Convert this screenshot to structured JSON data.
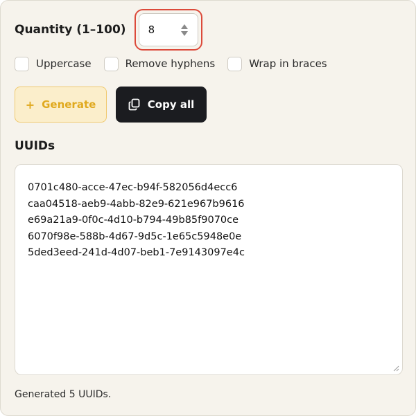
{
  "quantity": {
    "label": "Quantity (1–100)",
    "value": "8"
  },
  "options": [
    {
      "label": "Uppercase",
      "checked": false
    },
    {
      "label": "Remove hyphens",
      "checked": false
    },
    {
      "label": "Wrap in braces",
      "checked": false
    }
  ],
  "buttons": {
    "generate_icon": "+",
    "generate_label": "Generate",
    "copy_label": "Copy all"
  },
  "output": {
    "title": "UUIDs",
    "uuids": [
      "0701c480-acce-47ec-b94f-582056d4ecc6",
      "caa04518-aeb9-4abb-82e9-621e967b9616",
      "e69a21a9-0f0c-4d10-b794-49b85f9070ce",
      "6070f98e-588b-4d67-9d5c-1e65c5948e0e",
      "5ded3eed-241d-4d07-beb1-7e9143097e4c"
    ]
  },
  "status": "Generated 5 UUIDs.",
  "colors": {
    "panel_bg": "#f6f3ec",
    "focus_ring": "#dc4a3a",
    "generate_bg": "#fbeecb",
    "generate_text": "#e0a91e",
    "copy_bg": "#1b1c20"
  },
  "icons": {
    "copy": "copy-icon",
    "spinner": "spinner-arrows-icon",
    "resize": "resize-grip-icon"
  }
}
